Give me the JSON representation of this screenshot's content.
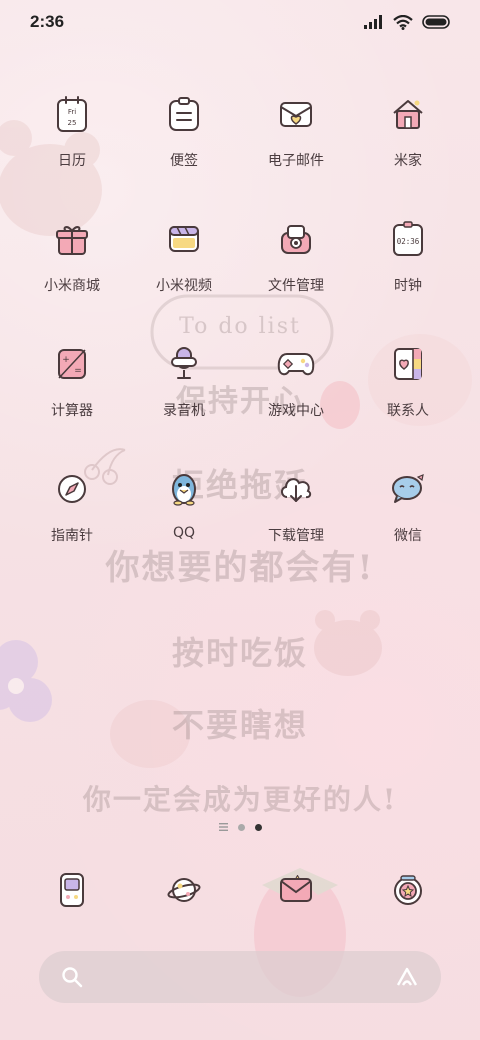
{
  "status_bar": {
    "time": "2:36",
    "icons": [
      "signal-icon",
      "wifi-icon",
      "battery-icon"
    ]
  },
  "apps": [
    {
      "label": "日历",
      "icon": "calendar-icon",
      "icon_text_top": "Fri",
      "icon_text_bottom": "25"
    },
    {
      "label": "便签",
      "icon": "notes-icon"
    },
    {
      "label": "电子邮件",
      "icon": "mail-icon"
    },
    {
      "label": "米家",
      "icon": "home-icon"
    },
    {
      "label": "小米商城",
      "icon": "gift-icon"
    },
    {
      "label": "小米视频",
      "icon": "video-icon"
    },
    {
      "label": "文件管理",
      "icon": "folder-icon"
    },
    {
      "label": "时钟",
      "icon": "clock-icon",
      "icon_text": "02:36"
    },
    {
      "label": "计算器",
      "icon": "calculator-icon"
    },
    {
      "label": "录音机",
      "icon": "recorder-icon"
    },
    {
      "label": "游戏中心",
      "icon": "gamepad-icon"
    },
    {
      "label": "联系人",
      "icon": "contacts-icon"
    },
    {
      "label": "指南针",
      "icon": "compass-icon"
    },
    {
      "label": "QQ",
      "icon": "qq-icon"
    },
    {
      "label": "下载管理",
      "icon": "download-icon"
    },
    {
      "label": "微信",
      "icon": "wechat-icon"
    }
  ],
  "wallpaper": {
    "line1": "To do list",
    "line2": "保持开心",
    "line3": "拒绝拖延",
    "line4": "你想要的都会有!",
    "line5": "按时吃饭",
    "line6": "不要瞎想",
    "line7": "你一定会成为更好的人!"
  },
  "pager": {
    "pages": 3,
    "active": 2
  },
  "dock": [
    {
      "icon": "phone-icon"
    },
    {
      "icon": "planet-icon"
    },
    {
      "icon": "messages-icon"
    },
    {
      "icon": "camera-icon"
    }
  ],
  "search": {
    "icon": "search-icon",
    "right_icon": "assistant-icon"
  },
  "colors": {
    "background": "#f7e3e6",
    "icon_stroke": "#4a3a3c",
    "pink": "#f3a9b6",
    "yellow": "#f7d982",
    "purple": "#c9b5e8"
  }
}
